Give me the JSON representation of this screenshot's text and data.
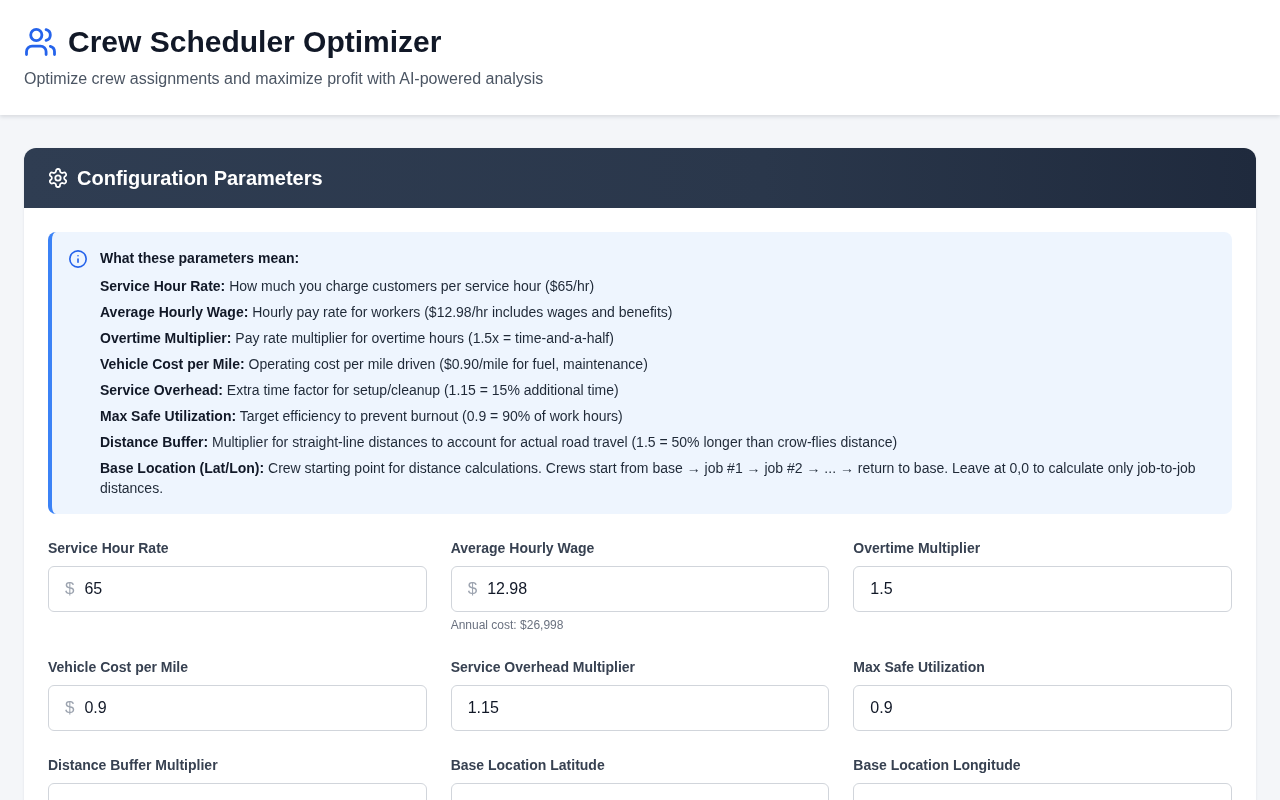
{
  "header": {
    "title": "Crew Scheduler Optimizer",
    "subtitle": "Optimize crew assignments and maximize profit with AI-powered analysis"
  },
  "config": {
    "title": "Configuration Parameters",
    "info": {
      "title": "What these parameters mean:",
      "items": [
        "**Service Hour Rate:** How much you charge customers per service hour ($65/hr)",
        "**Average Hourly Wage:** Hourly pay rate for workers ($12.98/hr includes wages and benefits)",
        "**Overtime Multiplier:** Pay rate multiplier for overtime hours (1.5x = time-and-a-half)",
        "**Vehicle Cost per Mile:** Operating cost per mile driven ($0.90/mile for fuel, maintenance)",
        "**Service Overhead:** Extra time factor for setup/cleanup (1.15 = 15% additional time)",
        "**Max Safe Utilization:** Target efficiency to prevent burnout (0.9 = 90% of work hours)",
        "**Distance Buffer:** Multiplier for straight-line distances to account for actual road travel (1.5 = 50% longer than crow-flies distance)",
        "**Base Location (Lat/Lon):** Crew starting point for distance calculations. Crews start from base → job #1 → job #2 → ... → return to base. Leave at 0,0 to calculate only job-to-job distances."
      ]
    },
    "fields": [
      {
        "label": "Service Hour Rate",
        "prefix": "$",
        "value": "65"
      },
      {
        "label": "Average Hourly Wage",
        "prefix": "$",
        "value": "12.98",
        "hint": "Annual cost: $26,998"
      },
      {
        "label": "Overtime Multiplier",
        "value": "1.5"
      },
      {
        "label": "Vehicle Cost per Mile",
        "prefix": "$",
        "value": "0.9"
      },
      {
        "label": "Service Overhead Multiplier",
        "value": "1.15"
      },
      {
        "label": "Max Safe Utilization",
        "value": "0.9"
      },
      {
        "label": "Distance Buffer Multiplier"
      },
      {
        "label": "Base Location Latitude"
      },
      {
        "label": "Base Location Longitude"
      }
    ]
  }
}
